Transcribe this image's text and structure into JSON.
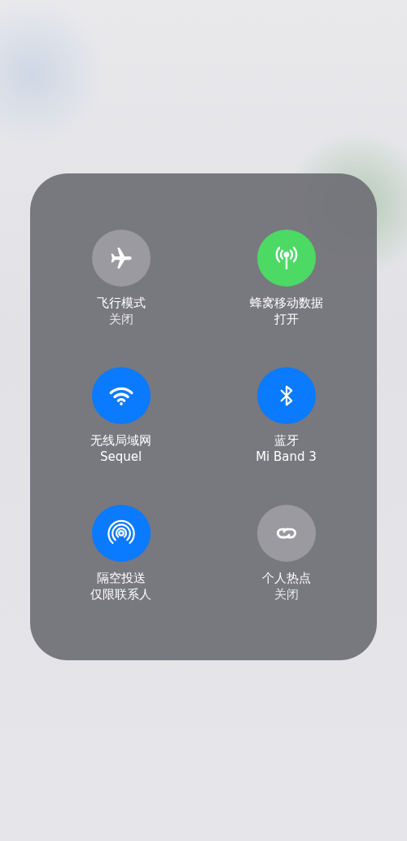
{
  "toggles": [
    {
      "kind": "airplane",
      "label": "飞行模式",
      "status": "关闭",
      "on": false
    },
    {
      "kind": "cellular",
      "label": "蜂窝移动数据",
      "status": "打开",
      "on": true,
      "color": "#4cd964"
    },
    {
      "kind": "wifi",
      "label": "无线局域网",
      "status": "Sequel",
      "on": true,
      "color": "#0a7aff"
    },
    {
      "kind": "bluetooth",
      "label": "蓝牙",
      "status": "Mi Band 3",
      "on": true,
      "color": "#0a7aff"
    },
    {
      "kind": "airdrop",
      "label": "隔空投送",
      "status": "仅限联系人",
      "on": true,
      "color": "#0a7aff"
    },
    {
      "kind": "hotspot",
      "label": "个人热点",
      "status": "关闭",
      "on": false
    }
  ]
}
